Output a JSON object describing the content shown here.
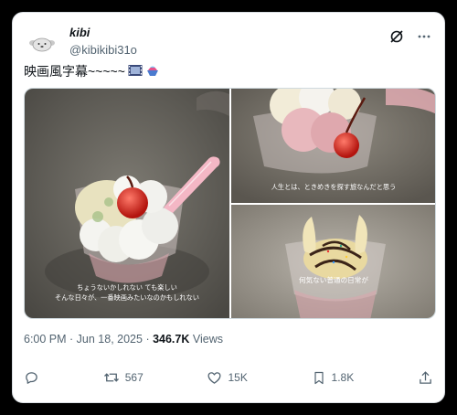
{
  "user": {
    "display_name": "kibi",
    "handle": "@kibikibi31o"
  },
  "tweet": {
    "text": "映画風字幕~~~~~"
  },
  "media": {
    "caption_1_line1": "ちょうないかしれない ても楽しい",
    "caption_1_line2": "そんな日々が、一番映画みたいなのかもしれない",
    "caption_2": "人生とは、ときめきを探す旅なんだと思う",
    "caption_3": "何気ない普通の日常が"
  },
  "meta": {
    "time": "6:00 PM",
    "separator": " · ",
    "date": "Jun 18, 2025",
    "views_count": "346.7K",
    "views_label": " Views"
  },
  "actions": {
    "retweets": "567",
    "likes": "15K",
    "bookmarks": "1.8K"
  },
  "icons": [
    "avatar",
    "grok-icon",
    "more-icon",
    "film-icon",
    "shaved-ice-icon",
    "reply-icon",
    "retweet-icon",
    "like-icon",
    "bookmark-icon",
    "share-icon"
  ],
  "colors": {
    "text": "#0f1419",
    "secondary": "#536471"
  }
}
